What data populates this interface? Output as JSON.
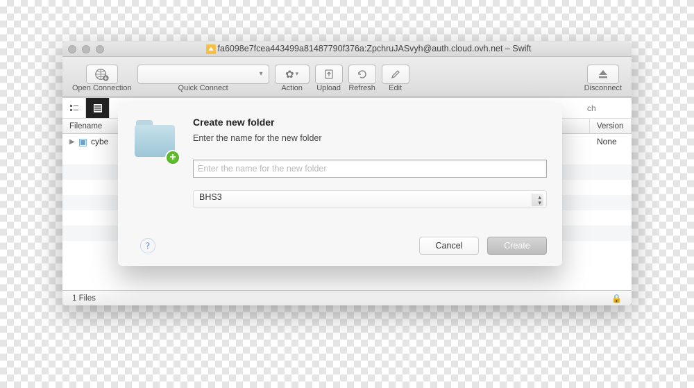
{
  "window": {
    "title": "fa6098e7fcea443499a81487790f376a:ZpchruJASvyh@auth.cloud.ovh.net – Swift"
  },
  "toolbar": {
    "open_connection": "Open Connection",
    "quick_connect": "Quick Connect",
    "action": "Action",
    "upload": "Upload",
    "refresh": "Refresh",
    "edit": "Edit",
    "disconnect": "Disconnect"
  },
  "columns": {
    "filename": "Filename",
    "version": "Version"
  },
  "search_placeholder": "ch",
  "rows": [
    {
      "name": "cybe",
      "version": "None"
    }
  ],
  "statusbar": {
    "count": "1 Files"
  },
  "modal": {
    "title": "Create new folder",
    "subtitle": "Enter the name for the new folder",
    "input_placeholder": "Enter the name for the new folder",
    "region": "BHS3",
    "cancel": "Cancel",
    "create": "Create"
  }
}
